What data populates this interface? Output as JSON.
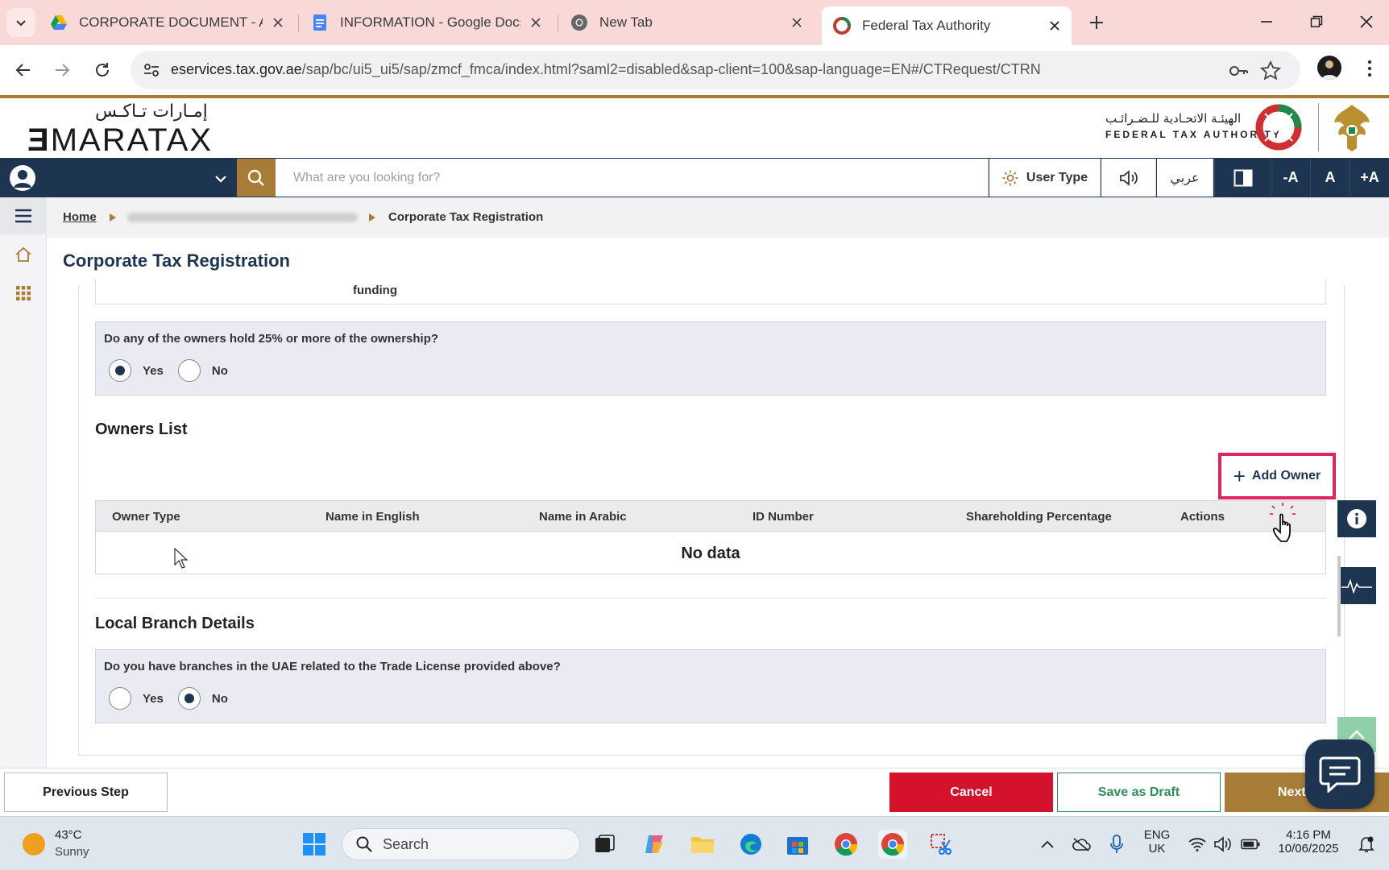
{
  "browser": {
    "tabs": [
      {
        "title": "CORPORATE DOCUMENT - Acc",
        "icon": "google-drive-icon"
      },
      {
        "title": "INFORMATION - Google Docs",
        "icon": "google-docs-icon"
      },
      {
        "title": "New Tab",
        "icon": "chrome-icon"
      },
      {
        "title": "Federal Tax Authority",
        "icon": "fta-favicon",
        "active": true
      }
    ],
    "url_domain": "eservices.tax.gov.ae",
    "url_path": "/sap/bc/ui5_ui5/sap/zmcf_fmca/index.html?saml2=disabled&sap-client=100&sap-language=EN#/CTRequest/CTRN"
  },
  "header": {
    "logo_arabic": "إمـارات تـاكـس",
    "logo_english_e": "Ǝ",
    "logo_english_rest": "MARATAX",
    "authority_arabic": "الهيئـة الاتحـادية للـضـرائـب",
    "authority_english": "FEDERAL TAX AUTHORITY"
  },
  "navbar": {
    "search_placeholder": "What are you looking for?",
    "user_type_label": "User Type",
    "arabic_label": "عربي",
    "font_decrease": "-A",
    "font_normal": "A",
    "font_increase": "+A"
  },
  "breadcrumb": {
    "home": "Home",
    "current": "Corporate Tax Registration"
  },
  "page": {
    "title": "Corporate Tax Registration",
    "previous_field_value": "funding"
  },
  "ownership_question": {
    "text": "Do any of the owners hold 25% or more of the ownership?",
    "yes_label": "Yes",
    "no_label": "No",
    "selected": "Yes"
  },
  "owners_list": {
    "title": "Owners List",
    "add_button": "Add Owner",
    "columns": [
      "Owner Type",
      "Name in English",
      "Name in Arabic",
      "ID Number",
      "Shareholding Percentage",
      "Actions"
    ],
    "empty_text": "No data"
  },
  "branch_section": {
    "title": "Local Branch Details",
    "question": "Do you have branches in the UAE related to the Trade License provided above?",
    "yes_label": "Yes",
    "no_label": "No",
    "selected": "No"
  },
  "footer": {
    "previous": "Previous Step",
    "cancel": "Cancel",
    "save_draft": "Save as Draft",
    "next": "Next"
  },
  "taskbar": {
    "temperature": "43°C",
    "condition": "Sunny",
    "search_label": "Search",
    "language_1": "ENG",
    "language_2": "UK",
    "time": "4:16 PM",
    "date": "10/06/2025"
  },
  "colors": {
    "navy": "#1e3552",
    "gold": "#a67c37",
    "cancel_red": "#d4122b",
    "highlight_pink": "#e0245e",
    "draft_green": "#2e8f5b"
  }
}
